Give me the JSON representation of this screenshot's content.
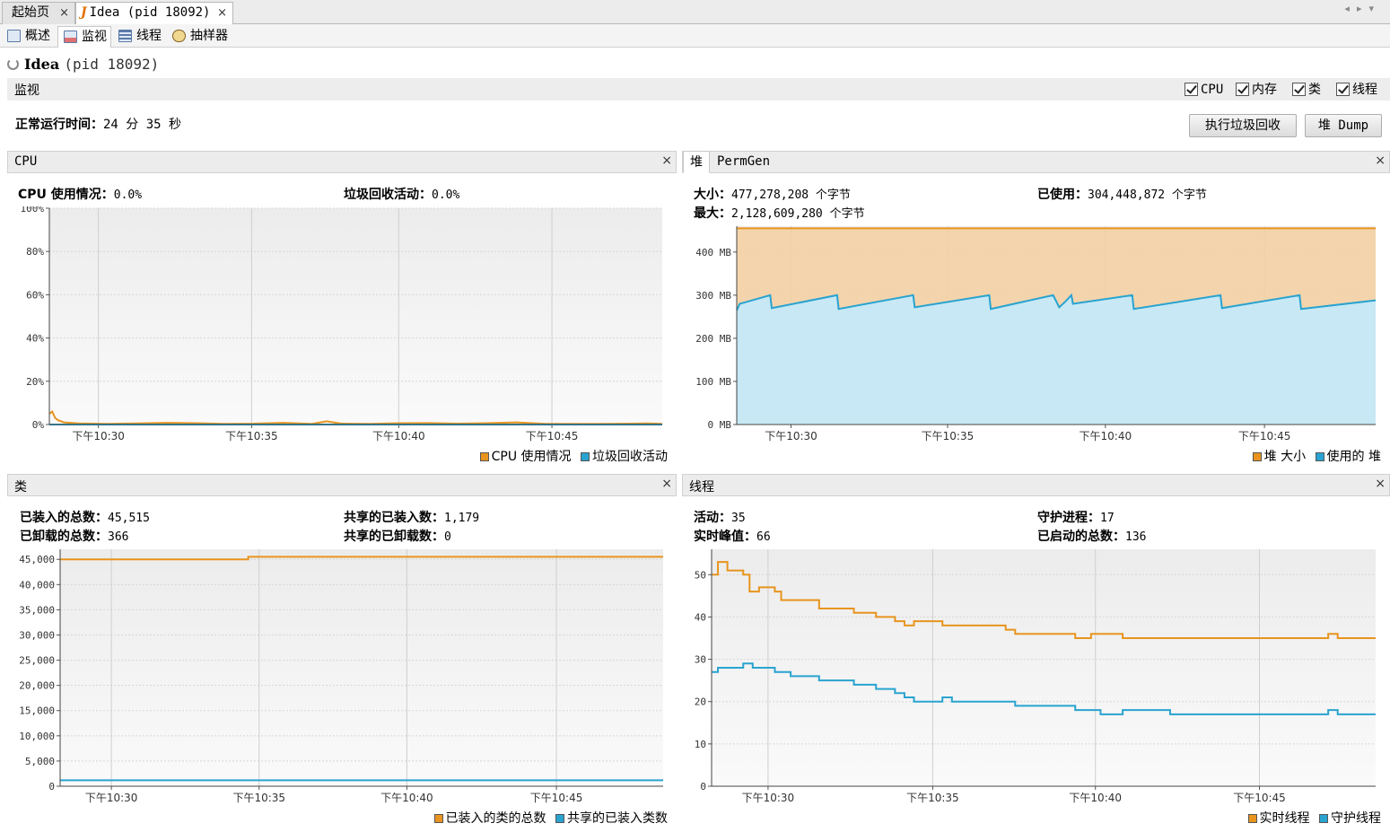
{
  "doc_tabs": [
    {
      "label": "起始页"
    },
    {
      "label": "Idea (pid 18092)"
    }
  ],
  "sub_tabs": [
    {
      "label": "概述",
      "icon": "overview-icon"
    },
    {
      "label": "监视",
      "icon": "monitor-chart-icon"
    },
    {
      "label": "线程",
      "icon": "threads-icon"
    },
    {
      "label": "抽样器",
      "icon": "sampler-icon"
    }
  ],
  "app": {
    "name": "Idea",
    "pid": "(pid 18092)"
  },
  "section": {
    "label": "监视",
    "checkboxes": [
      {
        "label": "CPU",
        "checked": true
      },
      {
        "label": "内存",
        "checked": true
      },
      {
        "label": "类",
        "checked": true
      },
      {
        "label": "线程",
        "checked": true
      }
    ]
  },
  "uptime": {
    "label": "正常运行时间：",
    "value": "24 分 35 秒"
  },
  "buttons": {
    "gc": "执行垃圾回收",
    "heap_dump": "堆 Dump"
  },
  "colors": {
    "orange": "#e8941e",
    "blue": "#29a3d0",
    "orange_fill": "#f5cfa0",
    "blue_fill": "#c4e9f8"
  },
  "cpu_panel": {
    "title": "CPU",
    "stats": [
      {
        "label": "CPU 使用情况：",
        "value": "0.0%"
      },
      {
        "label": "垃圾回收活动：",
        "value": "0.0%"
      }
    ],
    "legend": [
      "CPU 使用情况",
      "垃圾回收活动"
    ]
  },
  "heap_panel": {
    "tabs": [
      "堆",
      "PermGen"
    ],
    "stats": [
      {
        "label": "大小：",
        "value": "477,278,208 个字节"
      },
      {
        "label": "已使用：",
        "value": "304,448,872 个字节"
      },
      {
        "label": "最大：",
        "value": "2,128,609,280 个字节"
      }
    ],
    "legend": [
      "堆 大小",
      "使用的 堆"
    ]
  },
  "classes_panel": {
    "title": "类",
    "stats": [
      {
        "label": "已装入的总数：",
        "value": "45,515"
      },
      {
        "label": "共享的已装入数：",
        "value": "1,179"
      },
      {
        "label": "已卸载的总数：",
        "value": "366"
      },
      {
        "label": "共享的已卸载数：",
        "value": "0"
      }
    ],
    "legend": [
      "已装入的类的总数",
      "共享的已装入类数"
    ]
  },
  "threads_panel": {
    "title": "线程",
    "stats": [
      {
        "label": "活动：",
        "value": "35"
      },
      {
        "label": "守护进程：",
        "value": "17"
      },
      {
        "label": "实时峰值：",
        "value": "66"
      },
      {
        "label": "已启动的总数：",
        "value": "136"
      }
    ],
    "legend": [
      "实时线程",
      "守护线程"
    ]
  },
  "chart_data": [
    {
      "id": "cpu",
      "type": "line",
      "title": "",
      "x_ticks": [
        "下午10:30",
        "下午10:35",
        "下午10:40",
        "下午10:45"
      ],
      "y_ticks": [
        "100%",
        "80%",
        "60%",
        "40%",
        "20%",
        "0%"
      ],
      "ylim": [
        0,
        100
      ],
      "series": [
        {
          "name": "CPU 使用情况",
          "color": "#e8941e",
          "t": [
            0,
            0.1,
            0.2,
            0.3,
            0.5,
            1,
            2,
            3,
            4,
            5,
            6,
            7,
            8,
            9,
            9.5,
            10,
            11,
            12,
            13,
            14,
            15,
            16,
            17,
            18,
            19,
            20,
            20.5,
            21
          ],
          "values": [
            5,
            6,
            3,
            2,
            1,
            0.5,
            0.3,
            0.5,
            0.8,
            0.6,
            0.3,
            0.4,
            0.8,
            0.3,
            1.5,
            0.4,
            0.3,
            0.6,
            0.7,
            0.4,
            0.6,
            1.0,
            0.3,
            0.3,
            0.3,
            0.4,
            0.5,
            0.3
          ]
        },
        {
          "name": "垃圾回收活动",
          "color": "#29a3d0",
          "t": [
            0,
            21
          ],
          "values": [
            0,
            0
          ]
        }
      ]
    },
    {
      "id": "heap",
      "type": "area",
      "title": "",
      "x_ticks": [
        "下午10:30",
        "下午10:35",
        "下午10:40",
        "下午10:45"
      ],
      "y_ticks": [
        "400 MB",
        "300 MB",
        "200 MB",
        "100 MB",
        "0 MB"
      ],
      "ylim": [
        0,
        460
      ],
      "series": [
        {
          "name": "堆 大小",
          "color": "#e8941e",
          "t": [
            0,
            21
          ],
          "values": [
            455,
            455
          ]
        },
        {
          "name": "使用的 堆",
          "color": "#29a3d0",
          "t": [
            0,
            0.1,
            0.3,
            1.1,
            1.15,
            3.3,
            3.35,
            5.8,
            5.85,
            8.3,
            8.35,
            10.4,
            10.6,
            10.8,
            11.0,
            11.05,
            13.0,
            13.05,
            15.9,
            15.95,
            18.5,
            18.55,
            21
          ],
          "values": [
            265,
            280,
            284,
            300,
            270,
            300,
            268,
            300,
            272,
            300,
            268,
            300,
            272,
            285,
            300,
            280,
            300,
            268,
            300,
            270,
            300,
            268,
            288
          ]
        }
      ]
    },
    {
      "id": "classes",
      "type": "line",
      "title": "",
      "x_ticks": [
        "下午10:30",
        "下午10:35",
        "下午10:40",
        "下午10:45"
      ],
      "y_ticks": [
        "45,000",
        "40,000",
        "35,000",
        "30,000",
        "25,000",
        "20,000",
        "15,000",
        "10,000",
        "5,000",
        "0"
      ],
      "ylim": [
        0,
        47000
      ],
      "series": [
        {
          "name": "已装入的类的总数",
          "color": "#e8941e",
          "t": [
            0,
            6.5,
            6.55,
            21
          ],
          "values": [
            45000,
            45000,
            45515,
            45515
          ]
        },
        {
          "name": "共享的已装入类数",
          "color": "#29a3d0",
          "t": [
            0,
            21
          ],
          "values": [
            1179,
            1179
          ]
        }
      ]
    },
    {
      "id": "threads",
      "type": "line",
      "title": "",
      "x_ticks": [
        "下午10:30",
        "下午10:35",
        "下午10:40",
        "下午10:45"
      ],
      "y_ticks": [
        "50",
        "40",
        "30",
        "20",
        "10",
        "0"
      ],
      "ylim": [
        0,
        56
      ],
      "series": [
        {
          "name": "实时线程",
          "color": "#e8941e",
          "t": [
            0,
            0.2,
            0.5,
            1.0,
            1.2,
            1.5,
            2.0,
            2.2,
            3.4,
            4.5,
            5.2,
            5.8,
            6.1,
            6.4,
            7.3,
            7.6,
            9.3,
            9.6,
            11.5,
            12.0,
            12.3,
            13.0,
            13.2,
            14.5,
            19.5,
            19.8,
            21
          ],
          "values": [
            50,
            53,
            51,
            50,
            46,
            47,
            46,
            44,
            42,
            41,
            40,
            39,
            38,
            39,
            38,
            38,
            37,
            36,
            35,
            36,
            36,
            35,
            35,
            35,
            36,
            35,
            35
          ]
        },
        {
          "name": "守护线程",
          "color": "#29a3d0",
          "t": [
            0,
            0.2,
            1.0,
            1.3,
            2.0,
            2.5,
            3.4,
            4.5,
            5.2,
            5.8,
            6.1,
            6.4,
            7.3,
            7.6,
            9.3,
            9.6,
            11.5,
            12.0,
            12.3,
            13.0,
            13.2,
            14.5,
            19.5,
            19.8,
            21
          ],
          "values": [
            27,
            28,
            29,
            28,
            27,
            26,
            25,
            24,
            23,
            22,
            21,
            20,
            21,
            20,
            20,
            19,
            18,
            18,
            17,
            18,
            18,
            17,
            18,
            17,
            17
          ]
        }
      ]
    }
  ]
}
